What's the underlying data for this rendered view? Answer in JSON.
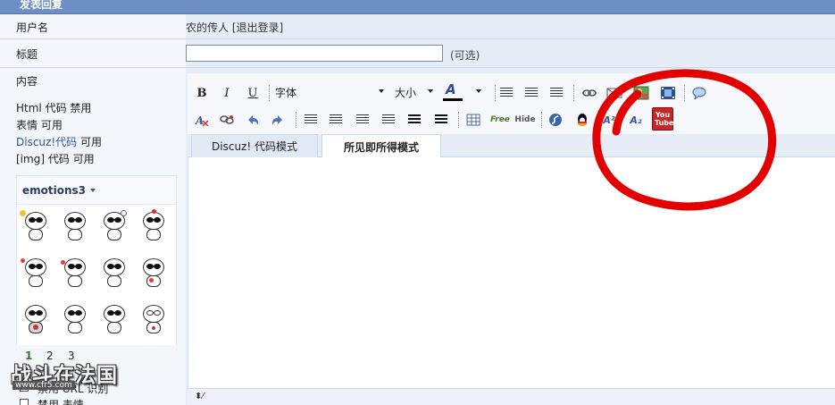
{
  "header": {
    "title": "发表回复"
  },
  "user_row": {
    "label": "用户名",
    "value": "农的传人 [退出登录]"
  },
  "title_row": {
    "label": "标题",
    "input_value": "",
    "optional_hint": "(可选)"
  },
  "content_row": {
    "label": "内容",
    "settings": [
      {
        "name": "Html 代码",
        "status": "禁用"
      },
      {
        "name": "表情",
        "status": "可用"
      },
      {
        "name": "Discuz!代码",
        "status": "可用"
      },
      {
        "name": "[img] 代码",
        "status": "可用"
      }
    ]
  },
  "emotions": {
    "selector_label": "emotions3",
    "pages": [
      "1",
      "2",
      "3"
    ],
    "current_page": "1"
  },
  "options": [
    {
      "label": "禁用 URL 识别",
      "checked": false
    },
    {
      "label": "禁用 表情",
      "checked": false
    }
  ],
  "toolbar": {
    "bold": "B",
    "italic": "I",
    "underline": "U",
    "font_label": "字体",
    "size_label": "大小",
    "color_label": "A",
    "free_label": "Free",
    "hide_label": "Hide",
    "superscript_label": "A²",
    "subscript_label": "A₂",
    "youtube_label": "You Tube"
  },
  "editor_tabs": [
    {
      "label": "Discuz! 代码模式",
      "active": false
    },
    {
      "label": "所见即所得模式",
      "active": true
    }
  ],
  "status_bar": {
    "text": "⬍⁄"
  },
  "watermark": {
    "title": "战斗在法国",
    "sub": "www.cfr5.com"
  },
  "colors": {
    "header_bg": "#6d8fc5",
    "row_bg": "#e6edf7",
    "label_bg": "#f3f6fb",
    "link": "#2a55a8",
    "annotation": "#e20000",
    "current_page": "#2d7d2d"
  }
}
